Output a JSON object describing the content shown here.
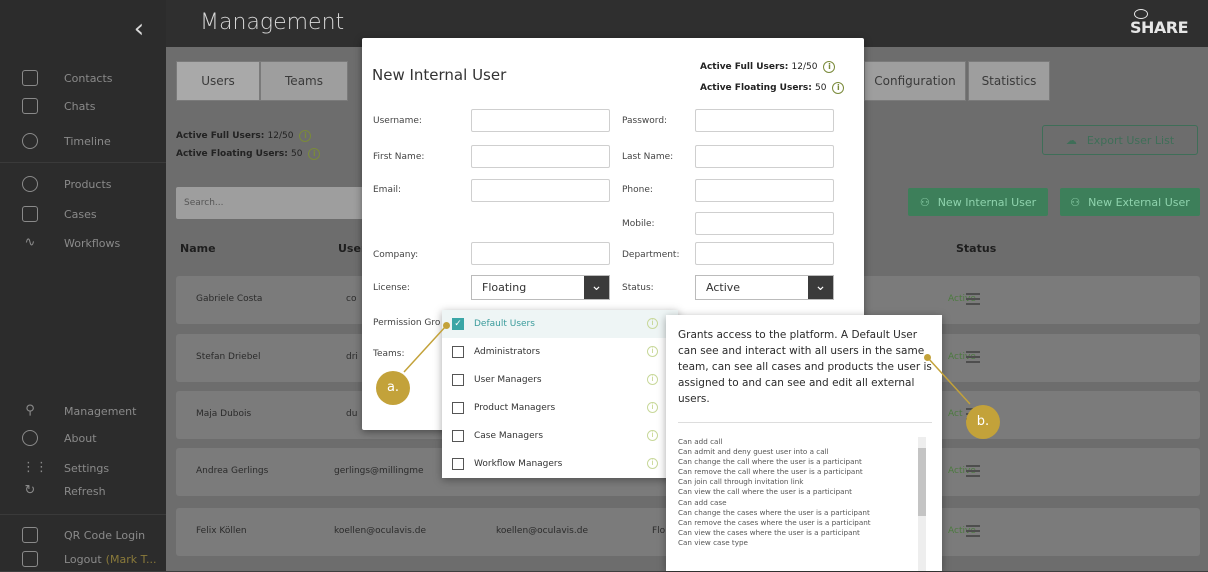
{
  "header": {
    "title": "Management",
    "brand": "SHARE",
    "back_icon": "chevron-left-icon"
  },
  "sidebar": {
    "items": [
      {
        "label": "Contacts",
        "icon": "contact-book-icon"
      },
      {
        "label": "Chats",
        "icon": "chat-bubble-icon"
      },
      {
        "label": "Timeline",
        "icon": "clock-icon"
      },
      {
        "label": "Products",
        "icon": "box-icon"
      },
      {
        "label": "Cases",
        "icon": "folder-icon"
      },
      {
        "label": "Workflows",
        "icon": "workflow-icon"
      },
      {
        "label": "Management",
        "icon": "key-icon"
      },
      {
        "label": "About",
        "icon": "info-icon"
      },
      {
        "label": "Settings",
        "icon": "sliders-icon"
      },
      {
        "label": "Refresh",
        "icon": "refresh-icon"
      },
      {
        "label": "QR Code Login",
        "icon": "qr-code-icon"
      },
      {
        "label": "Logout",
        "icon": "logout-icon",
        "extra": "(Mark T..."
      }
    ]
  },
  "tabs": [
    "Users",
    "Teams",
    "Configuration",
    "Statistics"
  ],
  "stats": {
    "full_label": "Active Full Users:",
    "full_value": "12/50",
    "floating_label": "Active Floating Users:",
    "floating_value": "50"
  },
  "search": {
    "placeholder": "Search..."
  },
  "buttons": {
    "export": "Export User List",
    "new_internal": "New Internal User",
    "new_external": "New External User"
  },
  "table": {
    "headers": {
      "name": "Name",
      "user": "User",
      "status": "Status"
    },
    "rows": [
      {
        "name": "Gabriele Costa",
        "user": "co",
        "email": "",
        "status": "Active"
      },
      {
        "name": "Stefan Driebel",
        "user": "dri",
        "email": "",
        "status": "Active"
      },
      {
        "name": "Maja Dubois",
        "user": "du",
        "email": "",
        "status": "Act"
      },
      {
        "name": "Andrea Gerlings",
        "user": "gerlings@millingme",
        "email": "",
        "status": "Active"
      },
      {
        "name": "Felix Köllen",
        "user": "koellen@oculavis.de",
        "email": "koellen@oculavis.de",
        "extra": "Flo",
        "status": "Active"
      }
    ]
  },
  "modal": {
    "title": "New Internal User",
    "labels": {
      "username": "Username:",
      "password": "Password:",
      "first_name": "First Name:",
      "last_name": "Last Name:",
      "email": "Email:",
      "phone": "Phone:",
      "mobile": "Mobile:",
      "company": "Company:",
      "department": "Department:",
      "license": "License:",
      "status": "Status:",
      "permission_groups": "Permission Gro",
      "teams": "Teams:"
    },
    "license_value": "Floating",
    "status_value": "Active"
  },
  "dropdown": {
    "items": [
      {
        "label": "Default Users",
        "checked": true
      },
      {
        "label": "Administrators",
        "checked": false
      },
      {
        "label": "User Managers",
        "checked": false
      },
      {
        "label": "Product Managers",
        "checked": false
      },
      {
        "label": "Case Managers",
        "checked": false
      },
      {
        "label": "Workflow Managers",
        "checked": false
      }
    ]
  },
  "tooltip": {
    "description": "Grants access to the platform. A Default User can see and interact with all users in the same team, can see all cases and products the user is assigned to and can see and edit all external users.",
    "permissions": [
      "Can add call",
      "Can admit and deny guest user into a call",
      "Can change the call where the user is a participant",
      "Can remove the call where the user is a participant",
      "Can join call through invitation link",
      "Can view the call where the user is a participant",
      "Can add case",
      "Can change the cases where the user is a participant",
      "Can remove the cases where the user is a participant",
      "Can view the cases where the user is a participant",
      "Can view case type"
    ]
  },
  "callouts": {
    "a": "a.",
    "b": "b."
  },
  "colors": {
    "accent_green": "#3d7f5a",
    "teal": "#3aa6a6",
    "callout": "#c3a23a"
  }
}
